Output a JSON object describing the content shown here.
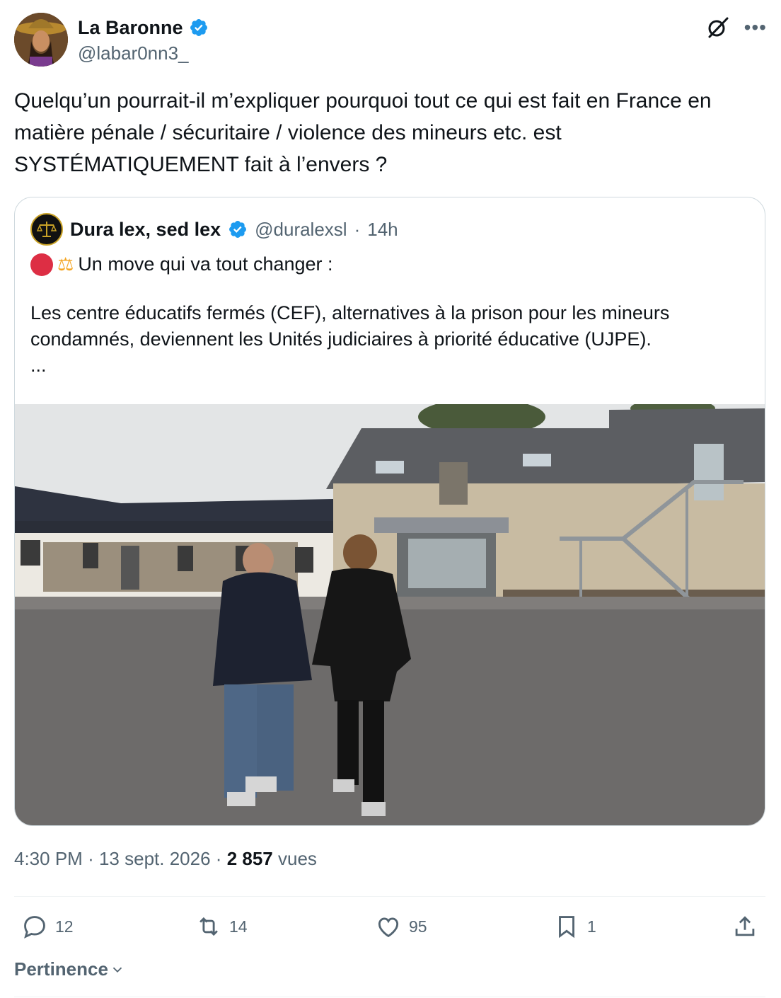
{
  "author": {
    "display_name": "La Baronne",
    "handle": "@labar0nn3_",
    "avatar": "avatar-image"
  },
  "tweet": {
    "text": "Quelqu’un pourrait-il m’expliquer pourquoi tout ce qui est fait en France en matière pénale / sécuritaire / violence des mineurs etc. est SYSTÉMATIQUEMENT fait à l’envers ?"
  },
  "quote": {
    "display_name": "Dura lex, sed lex",
    "handle": "@duralexsl",
    "separator": "·",
    "time": "14h",
    "line1": "Un move qui va tout changer :",
    "paragraph": "Les centre éducatifs fermés (CEF), alternatives à la prison pour les mineurs condamnés, deviennent les Unités judiciaires à priorité éducative (UJPE).",
    "ellipsis": "..."
  },
  "meta": {
    "time": "4:30 PM",
    "date": "13 sept. 2026",
    "sep": "·",
    "views_count": "2 857",
    "views_label": "vues"
  },
  "actions": {
    "replies": "12",
    "reposts": "14",
    "likes": "95",
    "bookmarks": "1"
  },
  "sort": {
    "label": "Pertinence"
  },
  "colors": {
    "verified": "#1d9bf0",
    "secondary_text": "#536471",
    "border": "#cfd9de"
  }
}
